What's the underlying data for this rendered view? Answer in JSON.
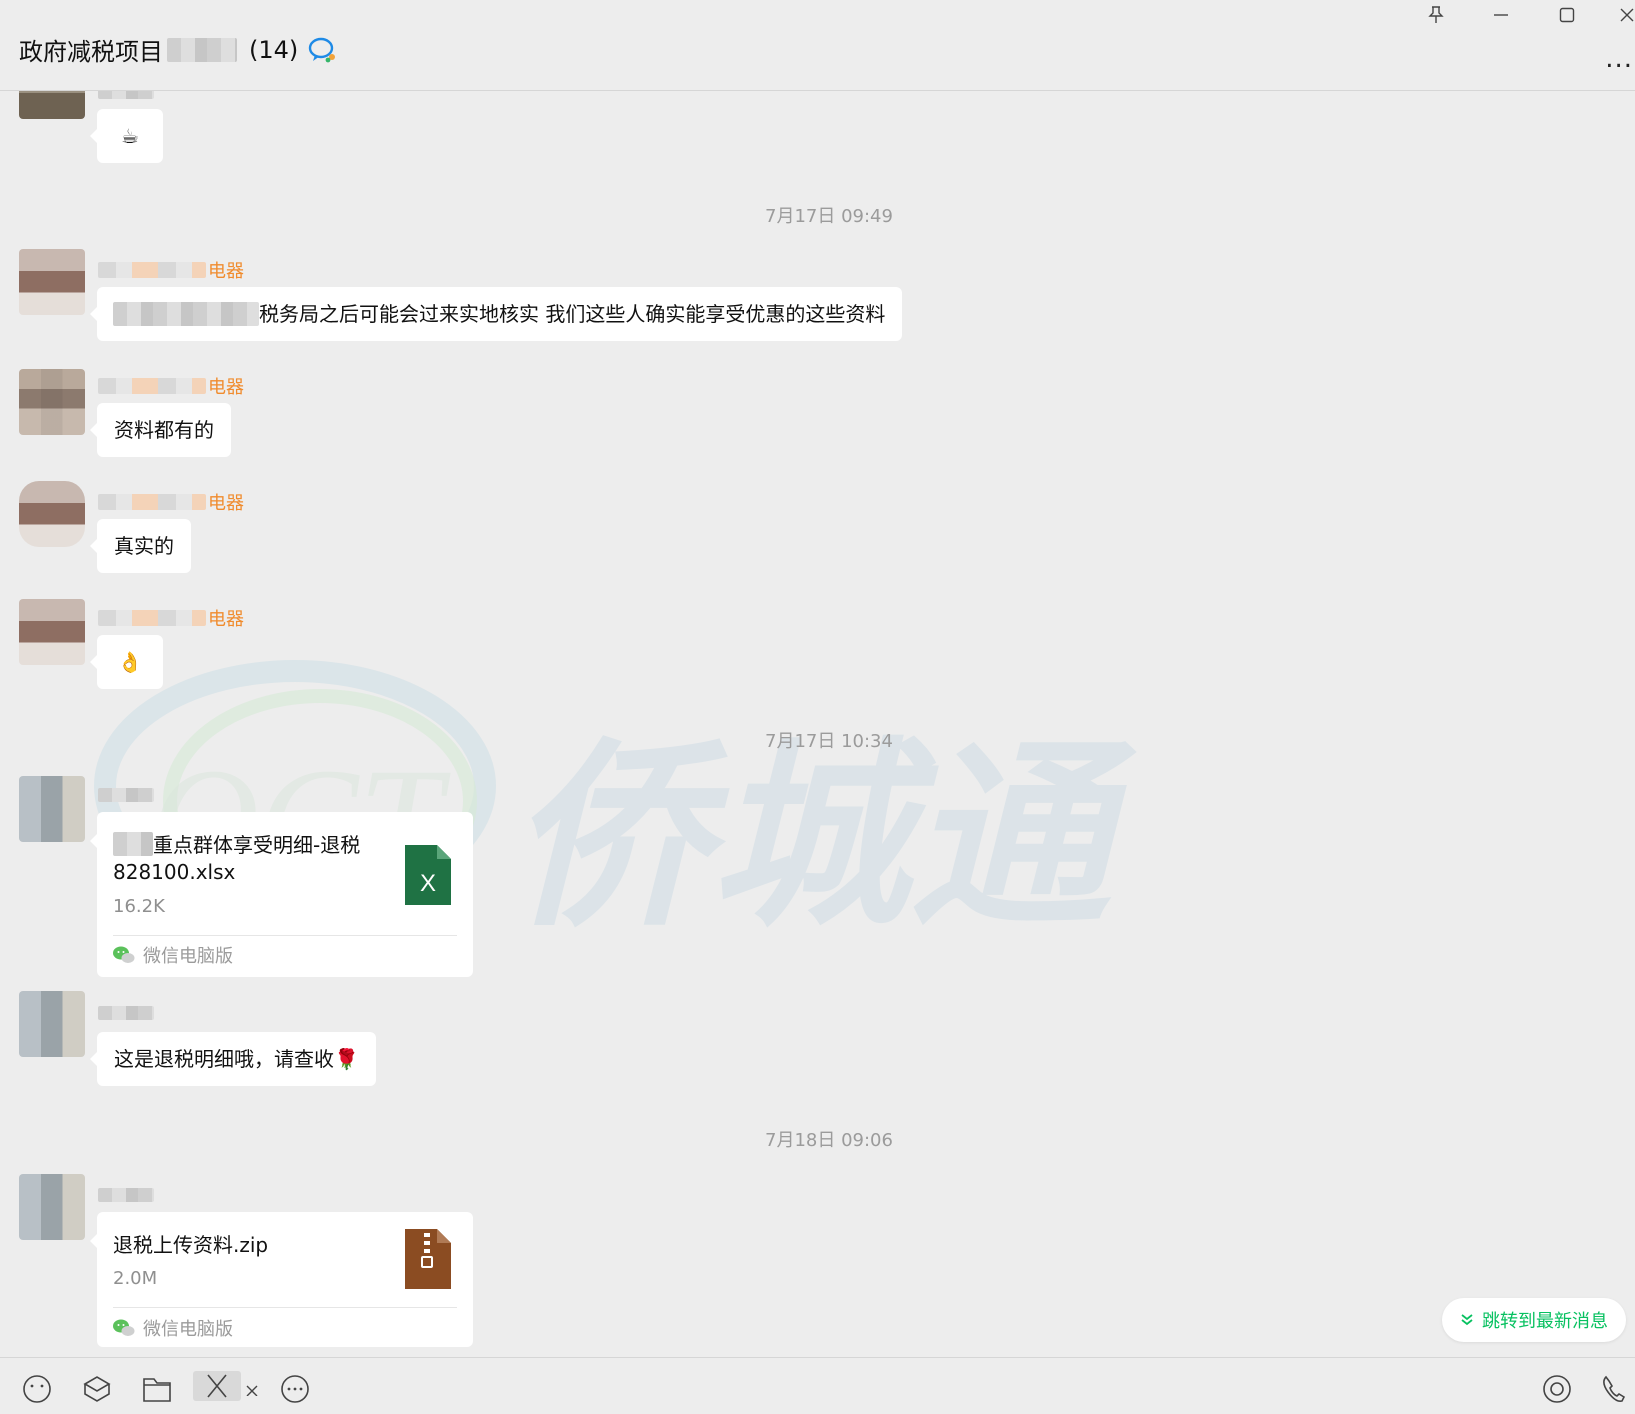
{
  "window": {
    "title": "政府减税项目",
    "member_count": "(14)",
    "controls": [
      "pin-icon",
      "minimize-icon",
      "maximize-icon",
      "close-icon"
    ],
    "more_label": "..."
  },
  "messages": {
    "ts1": "7月17日 09:49",
    "ts2": "7月17日 10:34",
    "ts3": "7月18日 09:06",
    "msg0_emoji": "☕",
    "m1_sender": "电器",
    "m1_text": "税务局之后可能会过来实地核实 我们这些人确实能享受优惠的这些资料",
    "m2_sender": "电器",
    "m2_text": "资料都有的",
    "m3_sender": "电器",
    "m3_text": "真实的",
    "m4_sender": "电器",
    "m4_emoji": "👌",
    "m5_file_name": "重点群体享受明细-退税828100.xlsx",
    "m5_file_size": "16.2K",
    "m5_source": "微信电脑版",
    "m6_text": "这是退税明细哦，请查收🌹",
    "m7_file_name": "退税上传资料.zip",
    "m7_file_size": "2.0M",
    "m7_source": "微信电脑版"
  },
  "jump_button": {
    "label": "跳转到最新消息"
  },
  "watermark": {
    "text": "侨城通",
    "latin": "QCT"
  },
  "colors": {
    "sender": "#f08c2e",
    "wechat_green": "#07c160",
    "excel_green": "#1f7244",
    "zip_brown": "#8b4c22"
  }
}
